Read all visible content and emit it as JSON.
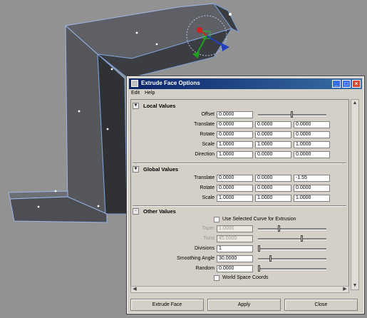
{
  "window": {
    "title": "Extrude Face Options",
    "controls": [
      "minimize-icon",
      "maximize-icon",
      "close-icon"
    ]
  },
  "menu": {
    "edit": "Edit",
    "help": "Help"
  },
  "local": {
    "title": "Local Values",
    "offset_label": "Offset",
    "offset": "0.0000",
    "translate_label": "Translate",
    "translate": [
      "0.0000",
      "0.0000",
      "0.0000"
    ],
    "rotate_label": "Rotate",
    "rotate": [
      "0.0000",
      "0.0000",
      "0.0000"
    ],
    "scale_label": "Scale",
    "scale": [
      "1.0000",
      "1.0000",
      "1.0000"
    ],
    "direction_label": "Direction",
    "direction": [
      "1.0000",
      "0.0000",
      "0.0000"
    ]
  },
  "global": {
    "title": "Global Values",
    "translate_label": "Translate",
    "translate": [
      "0.0000",
      "0.0000",
      "-1.55"
    ],
    "rotate_label": "Rotate",
    "rotate": [
      "0.0000",
      "0.0000",
      "0.0000"
    ],
    "scale_label": "Scale",
    "scale": [
      "1.0000",
      "1.0000",
      "1.0000"
    ]
  },
  "other": {
    "title": "Other Values",
    "use_curve_label": "Use Selected Curve for Extrusion",
    "taper_label": "Taper",
    "taper": "1.0000",
    "twist_label": "Twist",
    "twist": "45.0000",
    "divisions_label": "Divisions",
    "divisions": "1",
    "smoothing_label": "Smoothing Angle",
    "smoothing": "30.0000",
    "random_label": "Random",
    "random": "0.0000",
    "world_space_label": "World Space Coords"
  },
  "buttons": {
    "extrude": "Extrude Face",
    "apply": "Apply",
    "close": "Close"
  },
  "colors": {
    "accent": "#0a246a",
    "mesh": "#4a4d52",
    "viewport_bg": "#929292",
    "manip_red": "#d02020",
    "manip_green": "#20a020",
    "manip_blue": "#2040c0"
  }
}
